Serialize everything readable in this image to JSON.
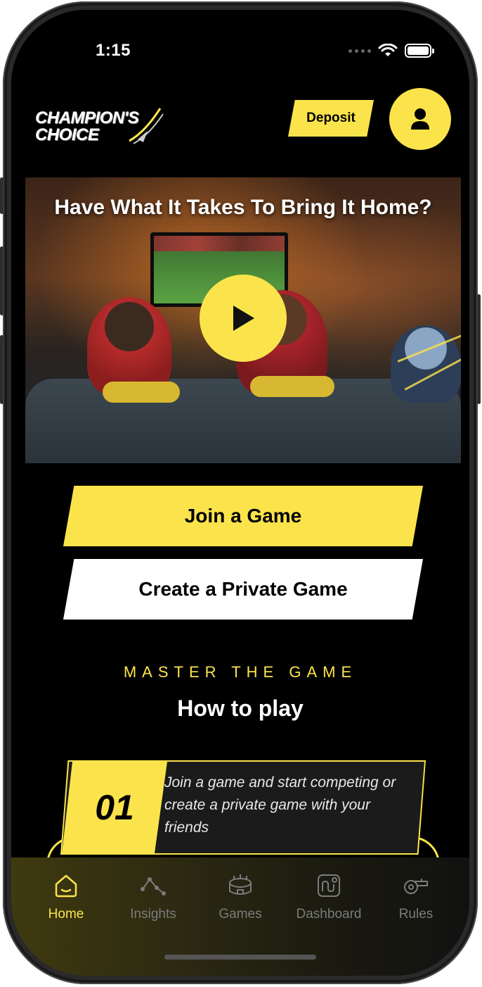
{
  "status": {
    "time": "1:15"
  },
  "header": {
    "logo_line1": "CHAMPION'S",
    "logo_line2": "CHOICE",
    "deposit_label": "Deposit"
  },
  "hero": {
    "title": "Have What It Takes To Bring It Home?"
  },
  "actions": {
    "join_label": "Join a Game",
    "private_label": "Create a Private Game"
  },
  "section": {
    "eyebrow": "MASTER THE GAME",
    "title": "How to play"
  },
  "steps": [
    {
      "number": "01",
      "text": "Join a game and start competing or create a private game with your friends"
    }
  ],
  "tabs": [
    {
      "label": "Home",
      "icon": "home-icon",
      "active": true
    },
    {
      "label": "Insights",
      "icon": "insights-icon",
      "active": false
    },
    {
      "label": "Games",
      "icon": "stadium-icon",
      "active": false
    },
    {
      "label": "Dashboard",
      "icon": "dashboard-icon",
      "active": false
    },
    {
      "label": "Rules",
      "icon": "whistle-icon",
      "active": false
    }
  ],
  "colors": {
    "accent": "#fbe44b",
    "background": "#000000",
    "inactive": "#7b7b7b"
  }
}
